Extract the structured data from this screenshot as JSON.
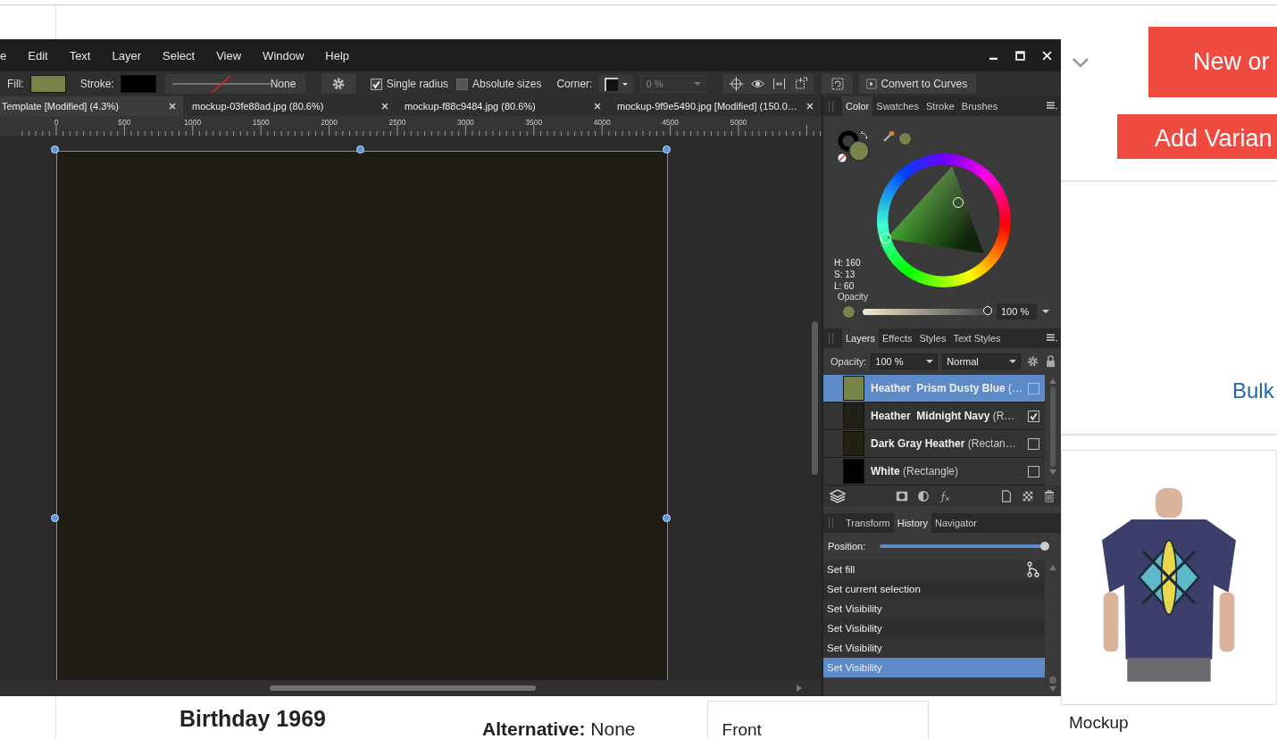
{
  "app": {
    "menu": [
      "e",
      "Edit",
      "Text",
      "Layer",
      "Select",
      "View",
      "Window",
      "Help"
    ],
    "toolbar": {
      "fill_label": "Fill:",
      "stroke_label": "Stroke:",
      "line_style": "None",
      "single_radius": {
        "label": "Single radius",
        "checked": true
      },
      "absolute_sizes": {
        "label": "Absolute sizes",
        "checked": false
      },
      "corner_label": "Corner:",
      "corner_amount": "0 %",
      "convert_button": "Convert to Curves"
    },
    "document_tabs": [
      {
        "label": "Template [Modified] (4.3%)",
        "selected": true
      },
      {
        "label": "mockup-03fe88ad.jpg (80.6%)",
        "selected": false
      },
      {
        "label": "mockup-f88c9484.jpg (80.6%)",
        "selected": false
      },
      {
        "label": "mockup-9f9e5490.jpg [Modified] (150.0…",
        "selected": false
      }
    ],
    "ruler": [
      "0",
      "500",
      "1000",
      "1500",
      "2000",
      "2500",
      "3000",
      "3500",
      "4000",
      "4500",
      "5000"
    ],
    "color_panel": {
      "tabs": [
        {
          "label": "Color",
          "selected": true
        },
        {
          "label": "Swatches",
          "selected": false
        },
        {
          "label": "Stroke",
          "selected": false
        },
        {
          "label": "Brushes",
          "selected": false
        }
      ],
      "hsl": [
        "H: 160",
        "S: 13",
        "L: 60"
      ],
      "opacity_label": "Opacity",
      "opacity_slider": {
        "level": 1
      },
      "opacity_value": "100 %"
    },
    "layers_panel": {
      "tabs": [
        {
          "label": "Layers",
          "selected": true
        },
        {
          "label": "Effects",
          "selected": false
        },
        {
          "label": "Styles",
          "selected": false
        },
        {
          "label": "Text Styles",
          "selected": false
        }
      ],
      "opacity_label": "Opacity:",
      "opacity_value": "100 %",
      "blend_mode": "Normal",
      "layers": [
        {
          "name": "Heather  Prism Dusty Blue",
          "detail": "(…",
          "selected": true,
          "checked": false,
          "color": "#76844a"
        },
        {
          "name": "Heather  Midnight Navy",
          "detail": "(R…",
          "selected": false,
          "checked": true,
          "color": "#211f18"
        },
        {
          "name": "Dark Gray Heather",
          "detail": "(Rectan…",
          "selected": false,
          "checked": false,
          "color": "#22210f"
        },
        {
          "name": "White",
          "detail": "(Rectangle)",
          "selected": false,
          "checked": false,
          "color": "#000000"
        }
      ]
    },
    "history_panel": {
      "tabs": [
        {
          "label": "Transform",
          "selected": false
        },
        {
          "label": "History",
          "selected": true
        },
        {
          "label": "Navigator",
          "selected": false
        }
      ],
      "position_label": "Position:",
      "position_slider": {
        "level": 1
      },
      "steps": [
        {
          "label": "Set fill",
          "selected": false
        },
        {
          "label": "Set current selection",
          "selected": false
        },
        {
          "label": "Set Visibility",
          "selected": false
        },
        {
          "label": "Set Visibility",
          "selected": false
        },
        {
          "label": "Set Visibility",
          "selected": false
        },
        {
          "label": "Set Visibility",
          "selected": true
        }
      ]
    }
  },
  "page": {
    "new_button": "New or",
    "add_button": "Add Varian",
    "bulk_link": "Bulk",
    "product_title": "Birthday 1969",
    "alternative_label": "Alternative:",
    "alternative_value": "None",
    "front_label": "Front",
    "mockup_label": "Mockup"
  }
}
